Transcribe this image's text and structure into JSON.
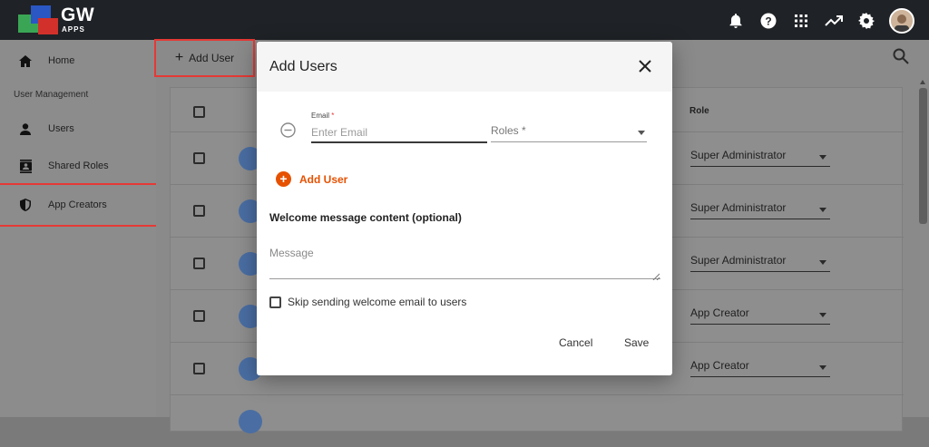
{
  "brand": {
    "logo_text": "GW",
    "logo_sub": "APPS"
  },
  "topbar": {
    "icons": [
      "bell-icon",
      "help-icon",
      "apps-grid-icon",
      "trending-icon",
      "gear-icon",
      "avatar"
    ]
  },
  "sidebar": {
    "section_label": "User Management",
    "items": [
      {
        "label": "Home",
        "icon": "home-icon"
      },
      {
        "label": "Users",
        "icon": "person-icon"
      },
      {
        "label": "Shared Roles",
        "icon": "contacts-icon"
      },
      {
        "label": "App Creators",
        "icon": "shield-icon"
      }
    ]
  },
  "toolbar": {
    "add_user_label": "Add User"
  },
  "table": {
    "role_header": "Role",
    "rows": [
      {
        "role": "Super Administrator"
      },
      {
        "role": "Super Administrator"
      },
      {
        "role": "Super Administrator"
      },
      {
        "role": "App Creator"
      },
      {
        "role": "App Creator"
      }
    ]
  },
  "dialog": {
    "title": "Add Users",
    "email_label": "Email",
    "email_required_mark": "*",
    "email_placeholder": "Enter Email",
    "roles_placeholder": "Roles *",
    "add_user_label": "Add User",
    "welcome_title": "Welcome message content (optional)",
    "message_placeholder": "Message",
    "skip_label": "Skip sending welcome email to users",
    "cancel_label": "Cancel",
    "save_label": "Save"
  },
  "colors": {
    "accent": "#e65100",
    "highlight": "#e53935",
    "topbar": "#1f2226"
  }
}
